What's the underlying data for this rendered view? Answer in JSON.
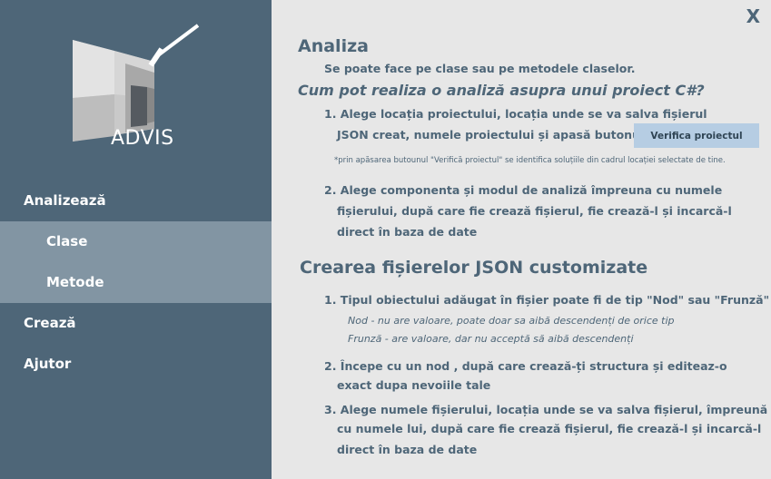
{
  "app": {
    "logo_text": "ADVIS",
    "close_label": "X"
  },
  "sidebar": {
    "items": [
      {
        "label": "Analizează"
      },
      {
        "label": "Clase"
      },
      {
        "label": "Metode"
      },
      {
        "label": "Crează"
      },
      {
        "label": "Ajutor"
      }
    ]
  },
  "content": {
    "section1": {
      "title": "Analiza",
      "subtitle": "Se poate face pe clase sau pe metodele claselor.",
      "question": "Cum pot realiza o analiză asupra unui proiect C#?",
      "step1_line1": "1. Alege locația proiectului, locația unde se va salva fișierul",
      "step1_line2": "JSON creat, numele proiectului și apasă butonul",
      "verify_button": "Verifica proiectul",
      "footnote": "*prin apăsarea butounul \"Verifică proiectul\" se identifica soluțiile din cadrul locației selectate de tine.",
      "step2_line1": "2. Alege componenta și modul de analiză împreuna cu numele",
      "step2_line2": "fișierului, după care fie crează fișierul, fie crează-l și incarcă-l",
      "step2_line3": "direct în baza de date"
    },
    "section2": {
      "title": "Crearea fișierelor JSON customizate",
      "step1": "1. Tipul obiectului adăugat în fișier poate fi de tip \"Nod\" sau \"Frunză\"",
      "step1_note1": "Nod - nu are valoare, poate doar sa aibă descendenți de orice tip",
      "step1_note2": "Frunză - are valoare, dar nu acceptă să aibă descendenți",
      "step2_line1": "2. Începe cu un nod , după care crează-ți structura și editeaz-o",
      "step2_line2": "exact dupa nevoiile tale",
      "step3_line1": "3. Alege numele fișierului, locația unde se va salva fișierul, împreună",
      "step3_line2": "cu numele lui, după care fie crează fișierul, fie crează-l și incarcă-l",
      "step3_line3": "direct în baza de date"
    }
  }
}
